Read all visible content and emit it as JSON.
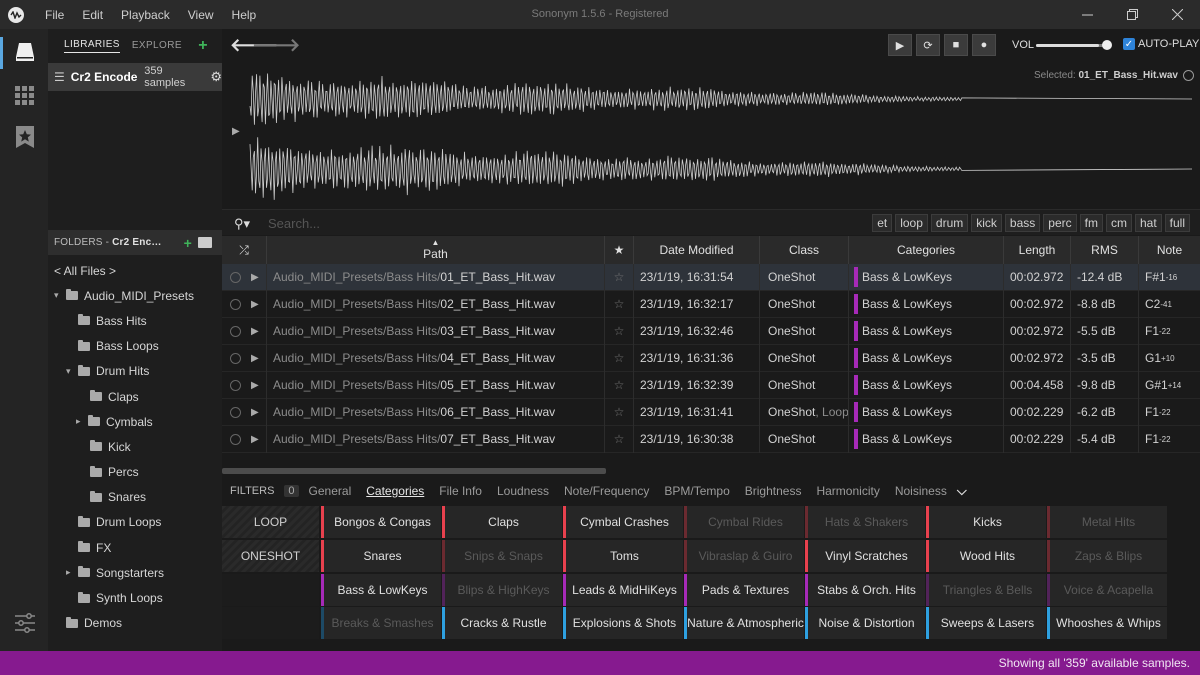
{
  "menu": [
    "File",
    "Edit",
    "Playback",
    "View",
    "Help"
  ],
  "window_title": "Sononym 1.5.6 - Registered",
  "library_tabs": {
    "libraries": "LIBRARIES",
    "explore": "EXPLORE"
  },
  "library": {
    "name": "Cr2 Encode…",
    "count": "359 samples"
  },
  "folders_header": {
    "prefix": "FOLDERS - ",
    "name": "Cr2 Enc…"
  },
  "tree": [
    {
      "label": "< All Files >",
      "indent": 0
    },
    {
      "label": "Audio_MIDI_Presets",
      "indent": 1,
      "expand": "▾"
    },
    {
      "label": "Bass Hits",
      "indent": 2
    },
    {
      "label": "Bass Loops",
      "indent": 2
    },
    {
      "label": "Drum Hits",
      "indent": 2,
      "expand": "▾"
    },
    {
      "label": "Claps",
      "indent": 3
    },
    {
      "label": "Cymbals",
      "indent": 3,
      "expand": "▸"
    },
    {
      "label": "Kick",
      "indent": 3
    },
    {
      "label": "Percs",
      "indent": 3
    },
    {
      "label": "Snares",
      "indent": 3
    },
    {
      "label": "Drum Loops",
      "indent": 2
    },
    {
      "label": "FX",
      "indent": 2
    },
    {
      "label": "Songstarters",
      "indent": 2,
      "expand": "▸"
    },
    {
      "label": "Synth Loops",
      "indent": 2
    },
    {
      "label": "Demos",
      "indent": 1
    }
  ],
  "transport": {
    "vol_label": "VOL",
    "volume": 0.9,
    "autoplay_label": "AUTO-PLAY"
  },
  "waveform": {
    "selected_prefix": "Selected: ",
    "selected_name": "01_ET_Bass_Hit.wav"
  },
  "search": {
    "placeholder": "Search..."
  },
  "tags": [
    "et",
    "loop",
    "drum",
    "kick",
    "bass",
    "perc",
    "fm",
    "cm",
    "hat",
    "full"
  ],
  "table": {
    "headers": [
      "Path",
      "★",
      "Date Modified",
      "Class",
      "Categories",
      "Length",
      "RMS",
      "Note"
    ],
    "rows": [
      {
        "dir": "Audio_MIDI_Presets/Bass Hits/",
        "file": "01_ET_Bass_Hit.wav",
        "date": "23/1/19, 16:31:54",
        "class": "OneShot",
        "class2": "",
        "cat": "Bass & LowKeys",
        "len": "00:02.972",
        "rms": "-12.4 dB",
        "note": "F#1",
        "cents": "-16",
        "selected": true
      },
      {
        "dir": "Audio_MIDI_Presets/Bass Hits/",
        "file": "02_ET_Bass_Hit.wav",
        "date": "23/1/19, 16:32:17",
        "class": "OneShot",
        "class2": "",
        "cat": "Bass & LowKeys",
        "len": "00:02.972",
        "rms": "-8.8 dB",
        "note": "C2",
        "cents": "-41"
      },
      {
        "dir": "Audio_MIDI_Presets/Bass Hits/",
        "file": "03_ET_Bass_Hit.wav",
        "date": "23/1/19, 16:32:46",
        "class": "OneShot",
        "class2": "",
        "cat": "Bass & LowKeys",
        "len": "00:02.972",
        "rms": "-5.5 dB",
        "note": "F1",
        "cents": "-22"
      },
      {
        "dir": "Audio_MIDI_Presets/Bass Hits/",
        "file": "04_ET_Bass_Hit.wav",
        "date": "23/1/19, 16:31:36",
        "class": "OneShot",
        "class2": "",
        "cat": "Bass & LowKeys",
        "len": "00:02.972",
        "rms": "-3.5 dB",
        "note": "G1",
        "cents": "+10"
      },
      {
        "dir": "Audio_MIDI_Presets/Bass Hits/",
        "file": "05_ET_Bass_Hit.wav",
        "date": "23/1/19, 16:32:39",
        "class": "OneShot",
        "class2": "",
        "cat": "Bass & LowKeys",
        "len": "00:04.458",
        "rms": "-9.8 dB",
        "note": "G#1",
        "cents": "+14"
      },
      {
        "dir": "Audio_MIDI_Presets/Bass Hits/",
        "file": "06_ET_Bass_Hit.wav",
        "date": "23/1/19, 16:31:41",
        "class": "OneShot",
        "class2": ", Loop",
        "cat": "Bass & LowKeys",
        "len": "00:02.229",
        "rms": "-6.2 dB",
        "note": "F1",
        "cents": "-22"
      },
      {
        "dir": "Audio_MIDI_Presets/Bass Hits/",
        "file": "07_ET_Bass_Hit.wav",
        "date": "23/1/19, 16:30:38",
        "class": "OneShot",
        "class2": "",
        "cat": "Bass & LowKeys",
        "len": "00:02.229",
        "rms": "-5.4 dB",
        "note": "F1",
        "cents": "-22"
      }
    ]
  },
  "filters": {
    "label": "FILTERS",
    "count": "0",
    "tabs": [
      "General",
      "Categories",
      "File Info",
      "Loudness",
      "Note/Frequency",
      "BPM/Tempo",
      "Brightness",
      "Harmonicity",
      "Noisiness"
    ],
    "active": "Categories"
  },
  "class_buttons": [
    "LOOP",
    "ONESHOT"
  ],
  "categories": [
    [
      {
        "l": "Bongos & Congas",
        "c": "#e8414e",
        "d": false
      },
      {
        "l": "Claps",
        "c": "#e8414e",
        "d": false
      },
      {
        "l": "Cymbal Crashes",
        "c": "#e8414e",
        "d": false
      },
      {
        "l": "Cymbal Rides",
        "c": "#6b2a30",
        "d": true
      },
      {
        "l": "Hats & Shakers",
        "c": "#6b2a30",
        "d": true
      },
      {
        "l": "Kicks",
        "c": "#e8414e",
        "d": false
      },
      {
        "l": "Metal Hits",
        "c": "#6b2a30",
        "d": true
      }
    ],
    [
      {
        "l": "Snares",
        "c": "#e8414e",
        "d": false
      },
      {
        "l": "Snips & Snaps",
        "c": "#6b2a30",
        "d": true
      },
      {
        "l": "Toms",
        "c": "#e8414e",
        "d": false
      },
      {
        "l": "Vibraslap & Guiro",
        "c": "#6b2a30",
        "d": true
      },
      {
        "l": "Vinyl Scratches",
        "c": "#e8414e",
        "d": false
      },
      {
        "l": "Wood Hits",
        "c": "#e8414e",
        "d": false
      },
      {
        "l": "Zaps & Blips",
        "c": "#6b2a30",
        "d": true
      }
    ],
    [
      {
        "l": "Bass & LowKeys",
        "c": "#a62ab8",
        "d": false
      },
      {
        "l": "Blips & HighKeys",
        "c": "#52235a",
        "d": true
      },
      {
        "l": "Leads & MidHiKeys",
        "c": "#a62ab8",
        "d": false
      },
      {
        "l": "Pads & Textures",
        "c": "#a62ab8",
        "d": false
      },
      {
        "l": "Stabs & Orch. Hits",
        "c": "#a62ab8",
        "d": false
      },
      {
        "l": "Triangles & Bells",
        "c": "#52235a",
        "d": true
      },
      {
        "l": "Voice & Acapella",
        "c": "#52235a",
        "d": true
      }
    ],
    [
      {
        "l": "Breaks & Smashes",
        "c": "#1d4a66",
        "d": true
      },
      {
        "l": "Cracks & Rustle",
        "c": "#2ea0e0",
        "d": false
      },
      {
        "l": "Explosions & Shots",
        "c": "#2ea0e0",
        "d": false
      },
      {
        "l": "Nature & Atmospheric",
        "c": "#2ea0e0",
        "d": false
      },
      {
        "l": "Noise & Distortion",
        "c": "#2ea0e0",
        "d": false
      },
      {
        "l": "Sweeps & Lasers",
        "c": "#2ea0e0",
        "d": false
      },
      {
        "l": "Whooshes & Whips",
        "c": "#2ea0e0",
        "d": false
      }
    ]
  ],
  "status": "Showing all '359' available samples."
}
